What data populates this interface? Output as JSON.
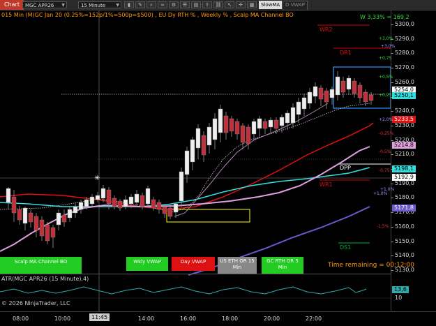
{
  "toolbar": {
    "chart_label": "Chart",
    "instrument": "MGC APR26",
    "interval": "15 Minute",
    "slowma_label": "SlowMA",
    "vwap_label": "D VWAP"
  },
  "chart_title": "015 Min (M)GC Jan 20  (0.25%=152p/1%=500p=$500) , EU Dy RTH % , Weekly % , Scalp MA Channel BO",
  "weekly_label": "W 3,33% = 169,2",
  "price_axis": [
    "5300,0",
    "5290,0",
    "5280,0",
    "5270,0",
    "5260,0",
    "5250,0",
    "5240,0",
    "5230,0",
    "5220,0",
    "5210,0",
    "5200,0",
    "5190,0",
    "5180,0",
    "5170,0",
    "5160,0",
    "5150,0",
    "5140,0",
    "5130,0"
  ],
  "price_tags": {
    "tag1": "5254,0",
    "tag2": "5250,1",
    "tag3": "5233,5",
    "tag4": "5214,8",
    "tag5": "5198,1",
    "tag6": "5192,9",
    "tag7": "5171,8",
    "tag_atr": "13,6"
  },
  "levels": {
    "wr2": "WR2",
    "dr1": "DR1",
    "dpp": "DPP",
    "wr1": "WR1",
    "ds1": "DS1"
  },
  "pct_labels": {
    "p1": "+3,0%",
    "p2": "+3,0%",
    "p3": "+0,75",
    "p4": "+0,5%",
    "p5": "+0,25",
    "p6": "+2,0%",
    "p7": "-0,25%",
    "p8": "-0,5%",
    "p9": "-0,75",
    "p10": "+1,0%",
    "p11": "+1,0%",
    "p12": "-1,5%"
  },
  "indicator_labels": {
    "scalp": "Scalp MA Channel BO",
    "wkly": "Wkly VWAP",
    "day": "Day VWAP",
    "us_eth": "US ETH OR 15 Min",
    "gc_rth": "GC RTH OR 5 Min"
  },
  "time_remaining": "Time remaining = 00:12:00",
  "atr_title": "ATR(MGC APR26 (15 Minute),4)",
  "atr_axis": [
    "10"
  ],
  "copyright": "© 2026 NinjaTrader, LLC",
  "time_axis": [
    "08:00",
    "10:00",
    "11:45",
    "14:00",
    "16:00",
    "18:00",
    "20:00",
    "22:00"
  ],
  "colors": {
    "accent_orange": "#ff9900",
    "ma_red": "#dd1111",
    "ma_cyan": "#33dddd",
    "ma_pink": "#dda0dd",
    "ma_blue": "#6a5acd"
  }
}
